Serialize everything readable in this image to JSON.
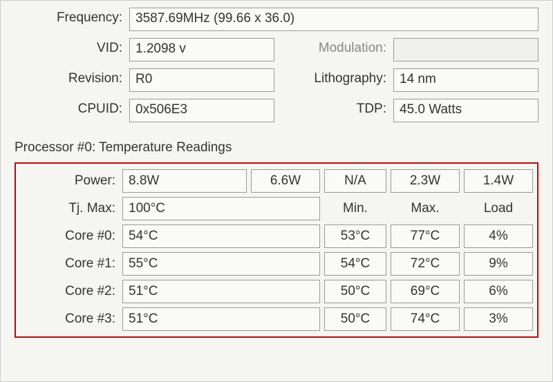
{
  "info": {
    "frequency_label": "Frequency:",
    "frequency_value": "3587.69MHz (99.66 x 36.0)",
    "vid_label": "VID:",
    "vid_value": "1.2098 v",
    "modulation_label": "Modulation:",
    "modulation_value": "",
    "revision_label": "Revision:",
    "revision_value": "R0",
    "lithography_label": "Lithography:",
    "lithography_value": "14 nm",
    "cpuid_label": "CPUID:",
    "cpuid_value": "0x506E3",
    "tdp_label": "TDP:",
    "tdp_value": "45.0 Watts"
  },
  "group_title": "Processor #0: Temperature Readings",
  "temp": {
    "power_label": "Power:",
    "power_cols": [
      "8.8W",
      "6.6W",
      "N/A",
      "2.3W",
      "1.4W"
    ],
    "tjmax_label": "Tj. Max:",
    "tjmax_value": "100°C",
    "headers": {
      "min": "Min.",
      "max": "Max.",
      "load": "Load"
    },
    "cores": [
      {
        "label": "Core #0:",
        "cur": "54°C",
        "min": "53°C",
        "max": "77°C",
        "load": "4%"
      },
      {
        "label": "Core #1:",
        "cur": "55°C",
        "min": "54°C",
        "max": "72°C",
        "load": "9%"
      },
      {
        "label": "Core #2:",
        "cur": "51°C",
        "min": "50°C",
        "max": "69°C",
        "load": "6%"
      },
      {
        "label": "Core #3:",
        "cur": "51°C",
        "min": "50°C",
        "max": "74°C",
        "load": "3%"
      }
    ]
  }
}
